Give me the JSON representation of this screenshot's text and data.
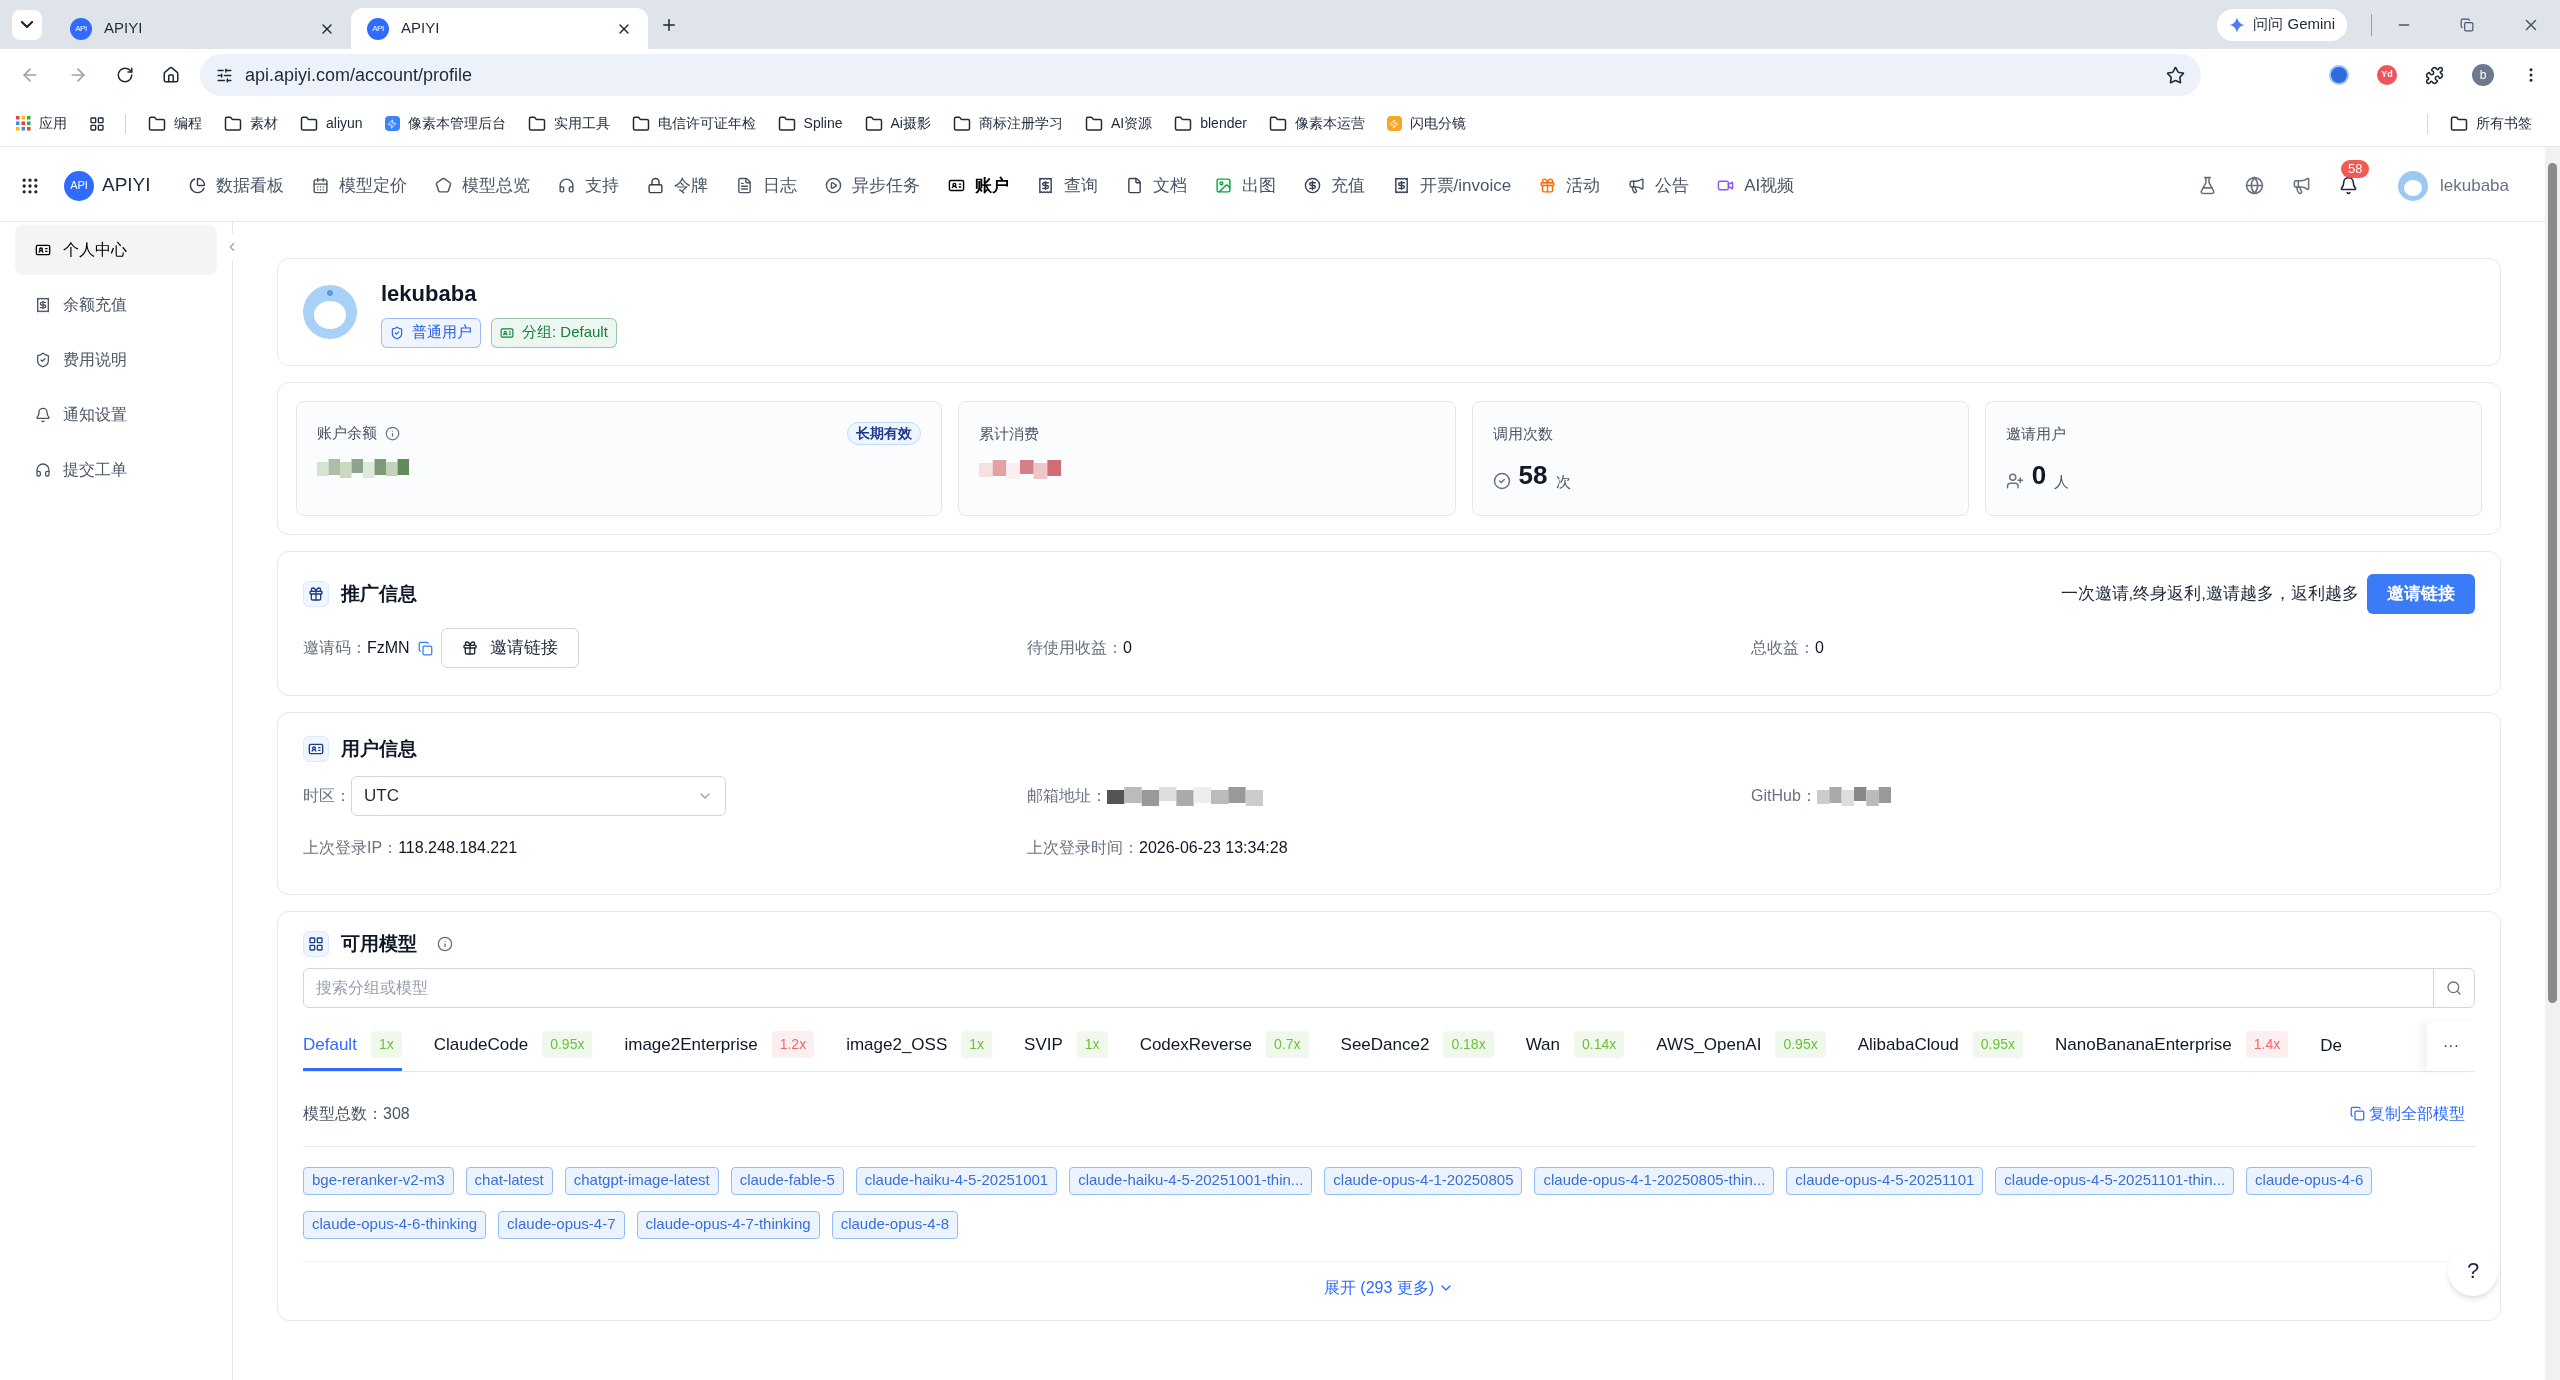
{
  "browser": {
    "tabs": [
      {
        "favicon": "API",
        "title": "APIYI",
        "selected": false
      },
      {
        "favicon": "API",
        "title": "APIYI",
        "selected": true
      }
    ],
    "gemini": "问问 Gemini",
    "address": "api.apiyi.com/account/profile",
    "extension_label": "Yd",
    "profile_initial": "b",
    "bookmarks": [
      {
        "kind": "apps",
        "label": "应用"
      },
      {
        "kind": "grid"
      },
      {
        "kind": "folder",
        "label": "编程"
      },
      {
        "kind": "folder",
        "label": "素材"
      },
      {
        "kind": "folder",
        "label": "aliyun"
      },
      {
        "kind": "site",
        "label": "像素本管理后台",
        "color": "#3b82f6"
      },
      {
        "kind": "folder",
        "label": "实用工具"
      },
      {
        "kind": "folder",
        "label": "电信许可证年检"
      },
      {
        "kind": "folder",
        "label": "Spline"
      },
      {
        "kind": "folder",
        "label": "Ai摄影"
      },
      {
        "kind": "folder",
        "label": "商标注册学习"
      },
      {
        "kind": "folder",
        "label": "AI资源"
      },
      {
        "kind": "folder",
        "label": "blender"
      },
      {
        "kind": "folder",
        "label": "像素本运营"
      },
      {
        "kind": "site",
        "label": "闪电分镜",
        "color": "#f6a623"
      }
    ],
    "all_bookmarks": "所有书签"
  },
  "nav": {
    "logo_badge": "API",
    "logo": "APIYI",
    "items": [
      {
        "label": "数据看板",
        "selected": false
      },
      {
        "label": "模型定价",
        "selected": false
      },
      {
        "label": "模型总览",
        "selected": false
      },
      {
        "label": "支持",
        "selected": false
      },
      {
        "label": "令牌",
        "selected": false
      },
      {
        "label": "日志",
        "selected": false
      },
      {
        "label": "异步任务",
        "selected": false
      },
      {
        "label": "账户",
        "selected": true
      },
      {
        "label": "查询",
        "selected": false
      },
      {
        "label": "文档",
        "selected": false
      },
      {
        "label": "出图",
        "selected": false
      },
      {
        "label": "充值",
        "selected": false
      },
      {
        "label": "开票/invoice",
        "selected": false
      },
      {
        "label": "活动",
        "selected": false
      },
      {
        "label": "公告",
        "selected": false
      },
      {
        "label": "AI视频",
        "selected": false
      }
    ],
    "notifications": "58",
    "user": "lekubaba"
  },
  "sidebar": {
    "items": [
      {
        "label": "个人中心",
        "selected": true
      },
      {
        "label": "余额充值",
        "selected": false
      },
      {
        "label": "费用说明",
        "selected": false
      },
      {
        "label": "通知设置",
        "selected": false
      },
      {
        "label": "提交工单",
        "selected": false
      }
    ]
  },
  "profile": {
    "name": "lekubaba",
    "badges": [
      {
        "label": "普通用户",
        "color": "#2563eb"
      },
      {
        "label": "分组: Default",
        "color": "#15803d"
      }
    ]
  },
  "stats": {
    "balance_label": "账户余额",
    "balance_badge": "长期有效",
    "spent_label": "累计消费",
    "calls_label": "调用次数",
    "calls": "58",
    "calls_unit": "次",
    "invited_label": "邀请用户",
    "invited": "0",
    "invited_unit": "人"
  },
  "promo": {
    "title": "推广信息",
    "code_label": "邀请码：",
    "code": "FzMN",
    "link_button": "邀请链接",
    "pending_label": "待使用收益：",
    "pending": "0",
    "total_label": "总收益：",
    "total": "0",
    "slogan": "一次邀请,终身返利,邀请越多，返利越多",
    "primary_button": "邀请链接"
  },
  "user_info": {
    "title": "用户信息",
    "timezone_label": "时区：",
    "timezone": "UTC",
    "email_label": "邮箱地址：",
    "github_label": "GitHub：",
    "ip_label": "上次登录IP：",
    "ip": "118.248.184.221",
    "login_time_label": "上次登录时间：",
    "login_time": "2026-06-23 13:34:28"
  },
  "models": {
    "title": "可用模型",
    "search_placeholder": "搜索分组或模型",
    "groups": [
      {
        "name": "Default",
        "ratio": "1x",
        "color": "#6cbf3f",
        "selected": true
      },
      {
        "name": "ClaudeCode",
        "ratio": "0.95x",
        "color": "#6cbf3f",
        "selected": false
      },
      {
        "name": "image2Enterprise",
        "ratio": "1.2x",
        "color": "#ef6a6a",
        "selected": false
      },
      {
        "name": "image2_OSS",
        "ratio": "1x",
        "color": "#6cbf3f",
        "selected": false
      },
      {
        "name": "SVIP",
        "ratio": "1x",
        "color": "#6cbf3f",
        "selected": false
      },
      {
        "name": "CodexReverse",
        "ratio": "0.7x",
        "color": "#6cbf3f",
        "selected": false
      },
      {
        "name": "SeeDance2",
        "ratio": "0.18x",
        "color": "#6cbf3f",
        "selected": false
      },
      {
        "name": "Wan",
        "ratio": "0.14x",
        "color": "#6cbf3f",
        "selected": false
      },
      {
        "name": "AWS_OpenAI",
        "ratio": "0.95x",
        "color": "#6cbf3f",
        "selected": false
      },
      {
        "name": "AlibabaCloud",
        "ratio": "0.95x",
        "color": "#6cbf3f",
        "selected": false
      },
      {
        "name": "NanoBananaEnterprise",
        "ratio": "1.4x",
        "color": "#ef6a6a",
        "selected": false
      }
    ],
    "cut_group": "De",
    "more": "···",
    "total_label": "模型总数：",
    "total": "308",
    "copy_all": "复制全部模型",
    "tags": [
      "bge-reranker-v2-m3",
      "chat-latest",
      "chatgpt-image-latest",
      "claude-fable-5",
      "claude-haiku-4-5-20251001",
      "claude-haiku-4-5-20251001-thin...",
      "claude-opus-4-1-20250805",
      "claude-opus-4-1-20250805-thin...",
      "claude-opus-4-5-20251101",
      "claude-opus-4-5-20251101-thin...",
      "claude-opus-4-6",
      "claude-opus-4-6-thinking",
      "claude-opus-4-7",
      "claude-opus-4-7-thinking",
      "claude-opus-4-8"
    ],
    "expand": "展开 (293 更多)"
  },
  "help": "?"
}
